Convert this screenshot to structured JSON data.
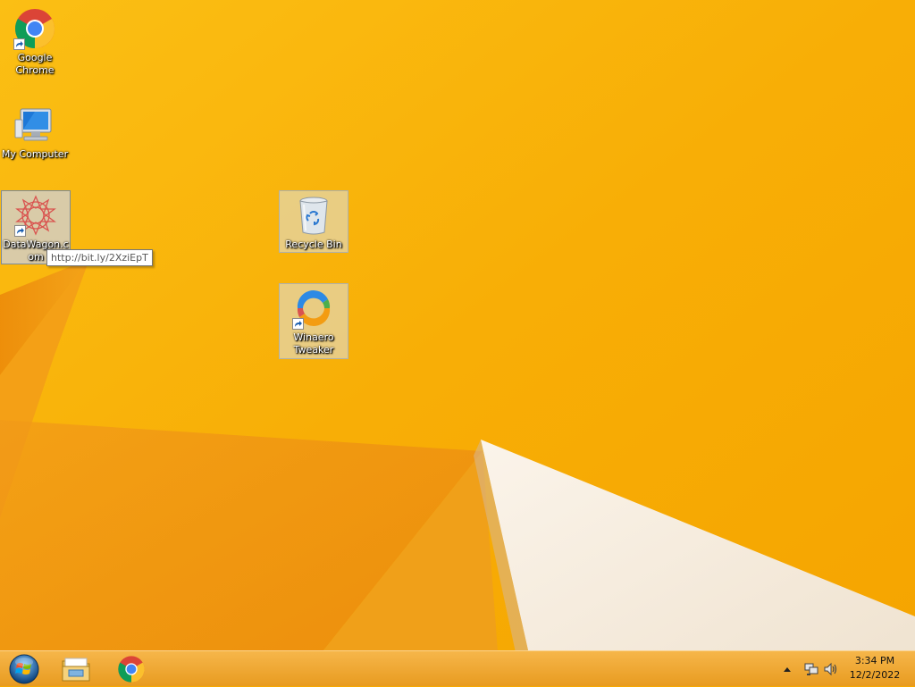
{
  "desktop": {
    "icons": [
      {
        "label": "Google Chrome"
      },
      {
        "label": "My Computer"
      },
      {
        "label": "DataWagon.com"
      },
      {
        "label": "Recycle Bin"
      },
      {
        "label": "Winaero Tweaker"
      }
    ],
    "tooltip": "http://bit.ly/2XziEpT"
  },
  "taskbar": {
    "pinned": [
      {
        "name": "start-icon"
      },
      {
        "name": "file-explorer-icon"
      },
      {
        "name": "chrome-icon"
      }
    ],
    "tray": {
      "icons": [
        "show-hidden-icons-arrow",
        "network-icon",
        "volume-icon"
      ],
      "time": "3:34 PM",
      "date": "12/2/2022"
    }
  },
  "colors": {
    "wallpaper_primary": "#f7a900",
    "wallpaper_dark": "#e8760a",
    "wallpaper_light": "#f5e8d8",
    "taskbar": "#f0a835"
  }
}
